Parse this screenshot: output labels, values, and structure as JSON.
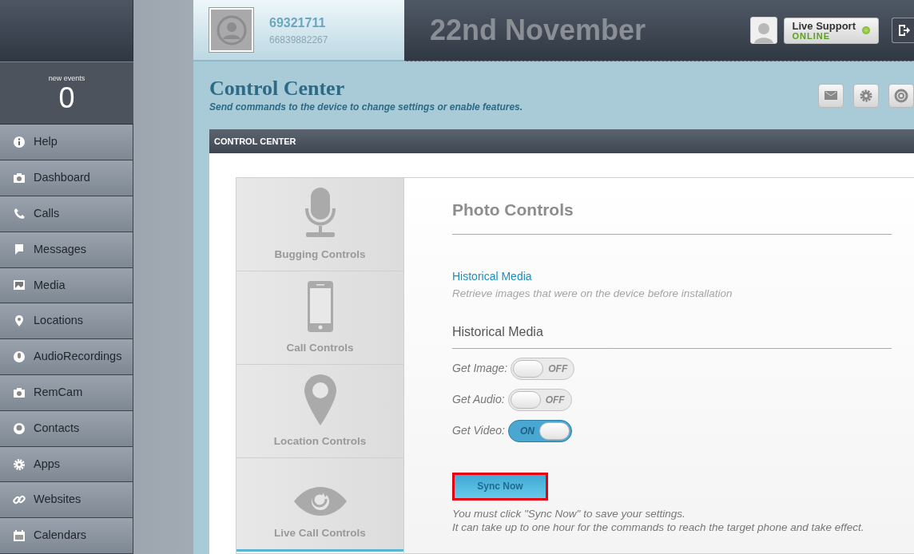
{
  "sidebar": {
    "new_events_label": "new events",
    "new_events_count": "0",
    "items": [
      {
        "label": "Help"
      },
      {
        "label": "Dashboard"
      },
      {
        "label": "Calls"
      },
      {
        "label": "Messages"
      },
      {
        "label": "Media"
      },
      {
        "label": "Locations"
      },
      {
        "label": "AudioRecordings"
      },
      {
        "label": "RemCam"
      },
      {
        "label": "Contacts"
      },
      {
        "label": "Apps"
      },
      {
        "label": "Websites"
      },
      {
        "label": "Calendars"
      }
    ]
  },
  "header": {
    "device_name": "69321711",
    "device_number": "66839882267",
    "date": "22nd November",
    "support_label": "Live Support",
    "support_status": "ONLINE"
  },
  "page": {
    "title": "Control Center",
    "subtitle": "Send commands to the device to change settings or enable features.",
    "panel_title": "CONTROL CENTER"
  },
  "control_tabs": [
    {
      "label": "Bugging Controls",
      "selected": false
    },
    {
      "label": "Call Controls",
      "selected": false
    },
    {
      "label": "Location Controls",
      "selected": false
    },
    {
      "label": "Live Call Controls",
      "selected": false
    }
  ],
  "photo_controls": {
    "title": "Photo Controls",
    "link": "Historical Media",
    "link_hint": "Retrieve images that were on the device before installation",
    "section_title": "Historical Media",
    "toggles": [
      {
        "label": "Get Image:",
        "state_text": "OFF",
        "on": false
      },
      {
        "label": "Get Audio:",
        "state_text": "OFF",
        "on": false
      },
      {
        "label": "Get Video:",
        "state_text": "ON",
        "on": true
      }
    ],
    "sync_button": {
      "label": "Sync Now",
      "highlighted": true
    },
    "notes": [
      "You must click \"Sync Now\" to save your settings.",
      "It can take up to one hour for the commands to reach the target phone and take effect."
    ]
  }
}
